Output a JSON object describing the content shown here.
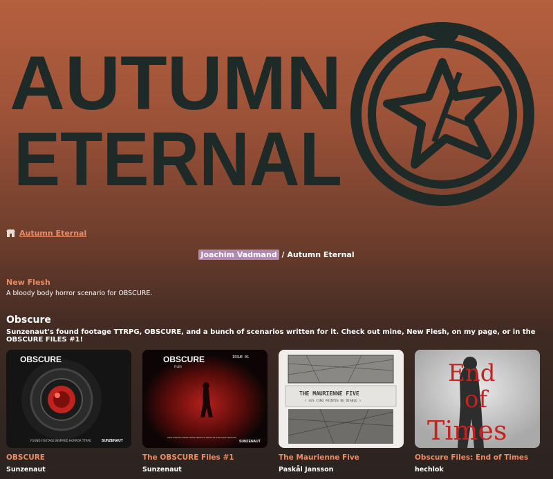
{
  "banner": {
    "line1": "AUTUMN",
    "line2": "ETERNAL"
  },
  "breadcrumb": {
    "icon": "store-icon",
    "link_label": "Autumn Eternal"
  },
  "page_header": {
    "author": "Joachim Vadmand",
    "separator": "/",
    "title": "Autumn Eternal"
  },
  "featured": {
    "title": "New Flesh",
    "description": "A bloody body horror scenario for OBSCURE."
  },
  "collection": {
    "heading": "Obscure",
    "description": "Sunzenaut's found footage TTRPG, OBSCURE, and a bunch of scenarios written for it. Check out mine, New Flesh, on my page, or in the OBSCURE FILES #1!",
    "games": [
      {
        "title": "OBSCURE",
        "author": "Sunzenaut",
        "cover": {
          "logo": "OBSCURE",
          "tagline": "FOUND FOOTAGE INSPIRED HORROR TTRPG",
          "publisher": "SUNZENAUT"
        }
      },
      {
        "title": "The OBSCURE Files #1",
        "author": "Sunzenaut",
        "cover": {
          "logo": "OBSCURE",
          "sub": "FILES",
          "issue": "ISSUE 01",
          "tagline": "TWELVE ADVENTURES COMMUNITY-CREATED SCENARIOS FOR OBSCURE, THE FOUND FOOTAGE HORROR TTRPG",
          "publisher": "SUNZENAUT"
        }
      },
      {
        "title": "The Maurienne Five",
        "author": "Paskål Jansson",
        "cover": {
          "logo": "THE MAURIENNE FIVE",
          "sub": "( LES CINQ POINTES DU DIABLE )"
        }
      },
      {
        "title": "Obscure Files: End of Times",
        "author": "hechlok",
        "cover": {
          "line1": "End",
          "line2": "of",
          "line3": "Times"
        }
      }
    ]
  },
  "colors": {
    "accent": "#ee8b65",
    "author_highlight": "#b388b0",
    "banner_ink": "#1d2a28"
  }
}
